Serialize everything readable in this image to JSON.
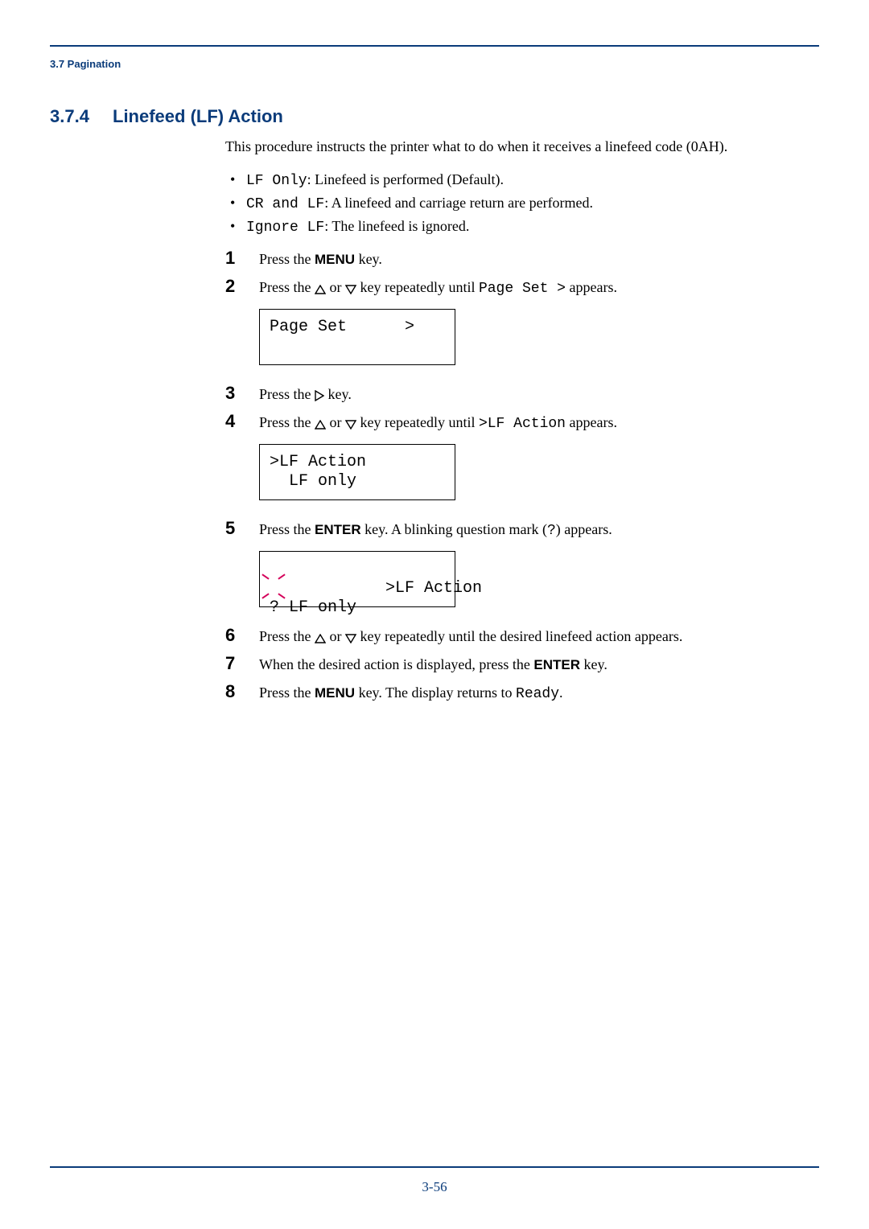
{
  "header": {
    "section": "3.7 Pagination"
  },
  "heading": {
    "num": "3.7.4",
    "title": "Linefeed (LF) Action"
  },
  "intro": "This procedure instructs the printer what to do when it receives a linefeed code (0AH).",
  "bullets": [
    {
      "code": "LF Only",
      "desc": ": Linefeed is performed (Default)."
    },
    {
      "code": "CR and LF",
      "desc": ": A linefeed and carriage return are performed."
    },
    {
      "code": "Ignore LF",
      "desc": ": The linefeed is ignored."
    }
  ],
  "steps": {
    "s1": {
      "n": "1",
      "a": "Press the ",
      "key": "MENU",
      "b": " key."
    },
    "s2": {
      "n": "2",
      "a": "Press the ",
      "mid": " or ",
      "b": " key repeatedly until ",
      "code": "Page Set >",
      "c": " appears.",
      "lcd": "Page Set      >\n "
    },
    "s3": {
      "n": "3",
      "a": "Press the ",
      "b": " key."
    },
    "s4": {
      "n": "4",
      "a": "Press the ",
      "mid": " or ",
      "b": " key repeatedly until ",
      "code": ">LF Action",
      "c": " appears.",
      "lcd": ">LF Action\n  LF only"
    },
    "s5": {
      "n": "5",
      "a": "Press the ",
      "key": "ENTER",
      "b": " key. A blinking question mark (",
      "q": "?",
      "c": ") appears.",
      "lcd": ">LF Action\n? LF only"
    },
    "s6": {
      "n": "6",
      "a": "Press the ",
      "mid": " or ",
      "b": " key repeatedly until the desired linefeed action appears."
    },
    "s7": {
      "n": "7",
      "a": "When the desired action is displayed, press the ",
      "key": "ENTER",
      "b": " key."
    },
    "s8": {
      "n": "8",
      "a": "Press the ",
      "key": "MENU",
      "b": " key. The display returns to ",
      "code": "Ready",
      "c": "."
    }
  },
  "footer": {
    "page": "3-56"
  },
  "icons": {
    "tri_up": "triangle-up",
    "tri_down": "triangle-down",
    "tri_right": "triangle-right"
  }
}
